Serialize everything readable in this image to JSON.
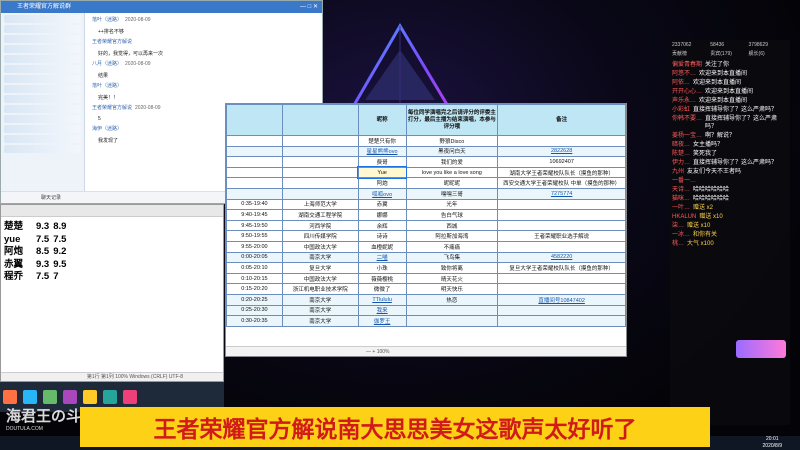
{
  "chat": {
    "title": "王者荣耀官方解说群",
    "messages": [
      {
        "user": "落叶（迷路）",
        "time": "2020-08-09",
        "text": "++排名不够"
      },
      {
        "user": "王者荣耀官方解说",
        "time": "",
        "text": "好的，我觉得，可以再来一次"
      },
      {
        "user": "八月（迷路）",
        "time": "2020-08-09",
        "text": "结果"
      },
      {
        "user": "落叶（迷路）",
        "time": "",
        "text": "完美！！"
      },
      {
        "user": "王者荣耀官方解说",
        "time": "2020-08-09",
        "text": "5"
      },
      {
        "user": "海伊（迷路）",
        "time": "",
        "text": "我发现了"
      }
    ],
    "toolbar_label": "聊天记录"
  },
  "scores": {
    "status": "第1行 第1列  100%  Windows (CRLF)  UTF-8",
    "rows": [
      {
        "name": "楚楚",
        "a": "9.3",
        "b": "8.9"
      },
      {
        "name": "yue",
        "a": "7.5",
        "b": "7.5"
      },
      {
        "name": "阿炮",
        "a": "8.5",
        "b": "9.2"
      },
      {
        "name": "赤翼",
        "a": "9.3",
        "b": "9.5"
      },
      {
        "name": "程乔",
        "a": "7.5",
        "b": "7"
      }
    ]
  },
  "sheet": {
    "headers": [
      "",
      "昵称",
      "每位同学演唱完之后请评分的评委主打分，最后主播为结束演唱，本参与评分哦",
      "备注"
    ],
    "rows": [
      {
        "time": "",
        "school": "",
        "nick": "楚楚只有你",
        "song": "野狼Disco",
        "note": "",
        "blue": false
      },
      {
        "time": "",
        "school": "",
        "nick": "星星熊熊ovo",
        "song": "黑夜问白天",
        "note": "2822628",
        "blue": true
      },
      {
        "time": "",
        "school": "",
        "nick": "费哥",
        "song": "我们的爱",
        "note": "10692407",
        "blue": false
      },
      {
        "time": "",
        "school": "",
        "nick": "Yue",
        "song": "love you like a love song",
        "note": "湖南大学王者荣耀校队队长（摸鱼的那种）",
        "blue": false
      },
      {
        "time": "",
        "school": "",
        "nick": "阿炮",
        "song": "昵昵昵",
        "note": "西安交通大学王者荣耀校队 中单（摸鱼的那种）",
        "blue": false
      },
      {
        "time": "",
        "school": "",
        "nick": "呱呱ovo",
        "song": "嘿嘿三哥",
        "note": "7275774",
        "blue": true
      },
      {
        "time": "0:35-19:40",
        "school": "上海师范大学",
        "nick": "赤翼",
        "song": "光年",
        "note": "",
        "blue": false
      },
      {
        "time": "9:40-19:45",
        "school": "湖南交通工程学院",
        "nick": "娜娜",
        "song": "告白气球",
        "note": "",
        "blue": false
      },
      {
        "time": "9:45-19:50",
        "school": "河西学院",
        "nick": "余辉",
        "song": "西城",
        "note": "",
        "blue": false
      },
      {
        "time": "9:50-19:55",
        "school": "四川传媒学院",
        "nick": "诗诗",
        "song": "阿拉斯加海湾",
        "note": "王者荣耀职业选手解说",
        "blue": false
      },
      {
        "time": "9:55-20:00",
        "school": "中国政法大学",
        "nick": "血橙妮妮",
        "song": "不痛痛",
        "note": "",
        "blue": false
      },
      {
        "time": "0:00-20:05",
        "school": "南京大学",
        "nick": "二喵",
        "song": "飞鸟集",
        "note": "4582220",
        "blue": true
      },
      {
        "time": "0:05-20:10",
        "school": "复旦大学",
        "nick": "小珠",
        "song": "致你将离",
        "note": "复旦大学王者荣耀校队队长（摸鱼的那种）",
        "blue": false
      },
      {
        "time": "0:10-20:15",
        "school": "中国政法大学",
        "nick": "薇薇樱桃",
        "song": "晴天花火",
        "note": "",
        "blue": false
      },
      {
        "time": "0:15-20:20",
        "school": "浙江机电职业技术学院",
        "nick": "微微了",
        "song": "明天快乐",
        "note": "",
        "blue": false
      },
      {
        "time": "0:20-20:25",
        "school": "南京大学",
        "nick": "TTlululu",
        "song": "热恋",
        "note": "直播间号10847402",
        "blue": true
      },
      {
        "time": "0:25-20:30",
        "school": "南京大学",
        "nick": "我来",
        "song": "",
        "note": "",
        "blue": true
      },
      {
        "time": "0:30-20:35",
        "school": "南京大学",
        "nick": "伽罗王",
        "song": "",
        "note": "",
        "blue": true
      }
    ],
    "status": "—  +  100%"
  },
  "danmaku": {
    "stats": [
      "2337062",
      "58436",
      "3798629",
      "贡献榜",
      "贵宾(179)",
      "舰长(6)"
    ],
    "items": [
      {
        "user": "偏爱青春期",
        "text": "关注了你",
        "gift": false
      },
      {
        "user": "阿悠不…",
        "text": "欢迎来到本直播间",
        "gift": false
      },
      {
        "user": "阿依…",
        "text": "欢迎来到本直播间",
        "gift": false
      },
      {
        "user": "开开心心…",
        "text": "欢迎来到本直播间",
        "gift": false
      },
      {
        "user": "声乐永…",
        "text": "欢迎来到本直播间",
        "gift": false
      },
      {
        "user": "小彩虹",
        "text": "直接挥辅导你了？这么严肃吗？",
        "gift": false
      },
      {
        "user": "你韩不要…",
        "text": "直接挥辅导你了？这么严肃吗？",
        "gift": false
      },
      {
        "user": "姜杨一宝…",
        "text": "啊？解说？",
        "gift": false
      },
      {
        "user": "暗夜…",
        "text": "女主播吗？",
        "gift": false
      },
      {
        "user": "陈楚…",
        "text": "笑死我了",
        "gift": false
      },
      {
        "user": "伊力…",
        "text": "直接挥辅导你了？这么严肃吗？",
        "gift": false
      },
      {
        "user": "九州",
        "text": "友友们今天不王者吗",
        "gift": false
      },
      {
        "user": "一番一…",
        "text": "",
        "gift": false
      },
      {
        "user": "天诗…",
        "text": "哈哈哈哈哈哈",
        "gift": false
      },
      {
        "user": "猫咪…",
        "text": "哈哈哈哈哈哈",
        "gift": false
      },
      {
        "user": "一叶…",
        "text": "赠送 x2",
        "gift": true
      },
      {
        "user": "HKALUN",
        "text": "赠送 x10",
        "gift": true
      },
      {
        "user": "柒…",
        "text": "赠送 x10",
        "gift": true
      },
      {
        "user": "一冰…",
        "text": "和你有关",
        "gift": true
      },
      {
        "user": "桃…",
        "text": "大气 x100",
        "gift": true
      }
    ]
  },
  "clock": {
    "time": "20:01",
    "date": "2020/8/9"
  },
  "caption": "王者荣耀官方解说南大思思美女这歌声太好听了",
  "watermark": {
    "main": "海君王の斗图",
    "sub": "DOUTULA.COM"
  },
  "colors": {
    "caption_bg": "#fcd116",
    "caption_text": "#d11a1a",
    "sheet_header": "#bfe6f4",
    "link": "#1557b0",
    "danmaku_user": "#ff5a5a"
  }
}
